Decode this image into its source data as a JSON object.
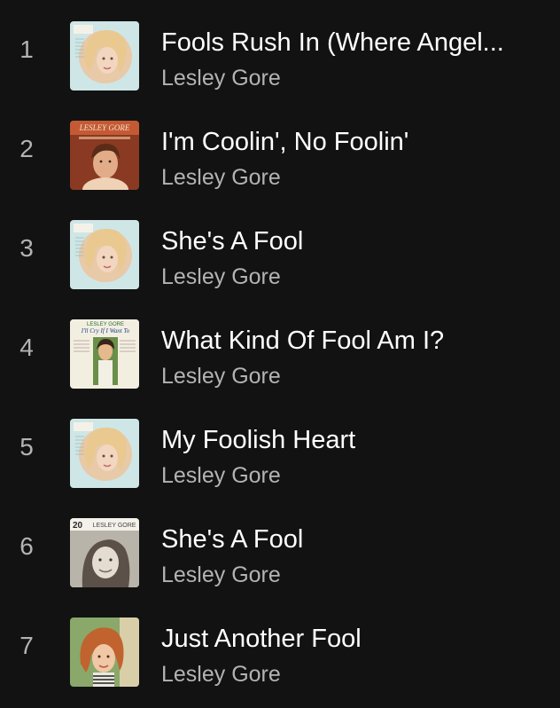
{
  "tracks": [
    {
      "number": "1",
      "title": "Fools Rush In (Where Angel...",
      "artist": "Lesley Gore",
      "cover": "lesley-gore-girl-talk-album-art",
      "cover_text": "Lesley Gore"
    },
    {
      "number": "2",
      "title": "I'm Coolin', No Foolin'",
      "artist": "Lesley Gore",
      "cover": "lesley-gore-sings-of-mixed-up-hearts-album-art",
      "cover_text": "LESLEY GORE"
    },
    {
      "number": "3",
      "title": "She's A Fool",
      "artist": "Lesley Gore",
      "cover": "lesley-gore-girl-talk-album-art",
      "cover_text": "Lesley Gore"
    },
    {
      "number": "4",
      "title": "What Kind Of Fool Am I?",
      "artist": "Lesley Gore",
      "cover": "lesley-gore-ill-cry-if-i-want-to-album-art",
      "cover_text": "LESLEY GORE I'll Cry If I Want To"
    },
    {
      "number": "5",
      "title": "My Foolish Heart",
      "artist": "Lesley Gore",
      "cover": "lesley-gore-girl-talk-album-art",
      "cover_text": "Lesley Gore"
    },
    {
      "number": "6",
      "title": "She's A Fool",
      "artist": "Lesley Gore",
      "cover": "lesley-gore-20th-century-masters-album-art",
      "cover_text": "20 LESLEY GORE"
    },
    {
      "number": "7",
      "title": "Just Another Fool",
      "artist": "Lesley Gore",
      "cover": "lesley-gore-portrait-album-art",
      "cover_text": ""
    }
  ],
  "colors": {
    "background": "#121212",
    "title": "#ffffff",
    "secondary": "#b3b3b3"
  }
}
